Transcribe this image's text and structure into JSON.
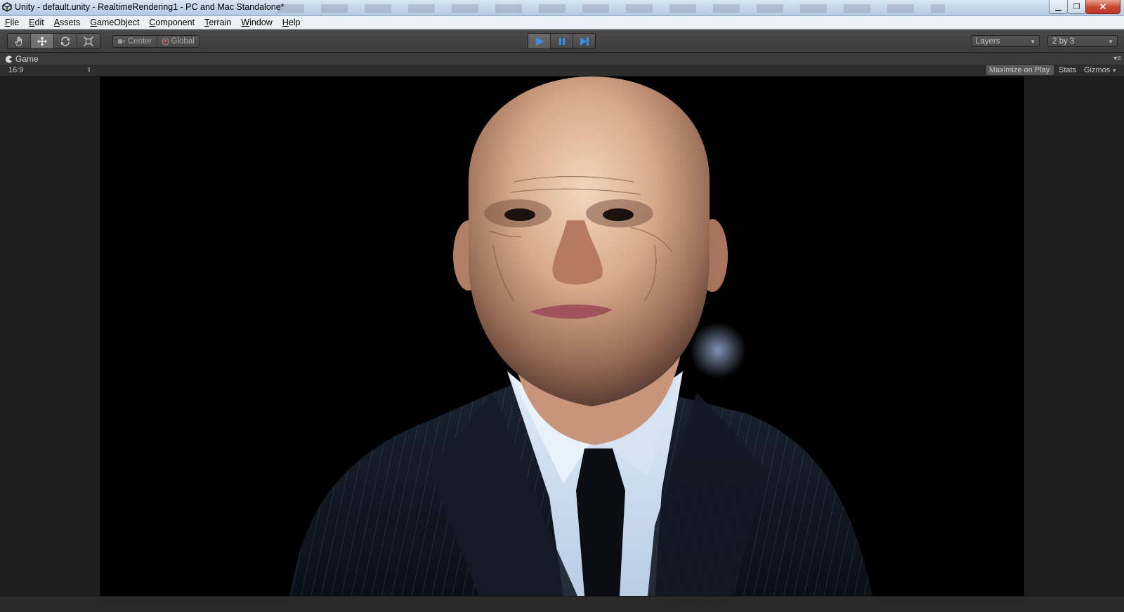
{
  "window": {
    "title": "Unity - default.unity - RealtimeRendering1 - PC and Mac Standalone*",
    "minimize_glyph": "▁",
    "maximize_glyph": "❐",
    "close_glyph": "✕"
  },
  "menu": {
    "items": [
      "File",
      "Edit",
      "Assets",
      "GameObject",
      "Component",
      "Terrain",
      "Window",
      "Help"
    ]
  },
  "toolbar": {
    "tools": [
      {
        "icon": "hand-icon"
      },
      {
        "icon": "move-icon",
        "active": true
      },
      {
        "icon": "rotate-icon"
      },
      {
        "icon": "scale-icon"
      }
    ],
    "pivot_mode": "Center",
    "pivot_rotation": "Global",
    "playback": {
      "play_icon": "play-icon",
      "pause_icon": "pause-icon",
      "step_icon": "step-icon",
      "playing": true
    },
    "layers_label": "Layers",
    "layout_label": "2 by 3",
    "accent": "#3d8ee8"
  },
  "game_view": {
    "tab_label": "Game",
    "aspect": "16:9",
    "maximize_on_play": "Maximize on Play",
    "stats": "Stats",
    "gizmos": "Gizmos"
  }
}
